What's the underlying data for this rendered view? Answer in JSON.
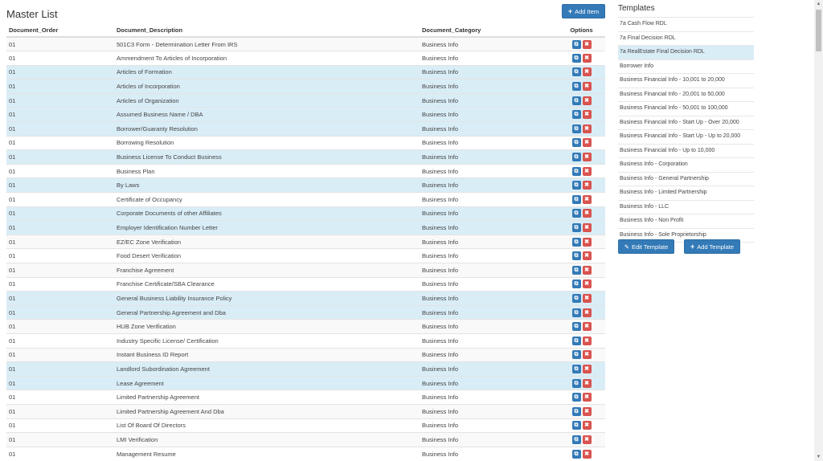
{
  "main": {
    "title": "Master List",
    "add_item_label": "Add Item",
    "columns": [
      "Document_Order",
      "Document_Description",
      "Document_Category",
      "Options"
    ],
    "rows": [
      {
        "order": "01",
        "desc": "501C3 Form - Determination Letter From IRS",
        "cat": "Business Info",
        "hl": false
      },
      {
        "order": "01",
        "desc": "Ammendment To Articles of Incorporation",
        "cat": "Business Info",
        "hl": false
      },
      {
        "order": "01",
        "desc": "Articles of Formation",
        "cat": "Business Info",
        "hl": true
      },
      {
        "order": "01",
        "desc": "Articles of Incorporation",
        "cat": "Business Info",
        "hl": true
      },
      {
        "order": "01",
        "desc": "Articles of Organization",
        "cat": "Business Info",
        "hl": true
      },
      {
        "order": "01",
        "desc": "Assumed Business Name / DBA",
        "cat": "Business Info",
        "hl": true
      },
      {
        "order": "01",
        "desc": "Borrower/Guaranty Resolution",
        "cat": "Business Info",
        "hl": true
      },
      {
        "order": "01",
        "desc": "Borrowing Resolution",
        "cat": "Business Info",
        "hl": false
      },
      {
        "order": "01",
        "desc": "Business License To Conduct Business",
        "cat": "Business Info",
        "hl": true
      },
      {
        "order": "01",
        "desc": "Business Plan",
        "cat": "Business Info",
        "hl": false
      },
      {
        "order": "01",
        "desc": "By Laws",
        "cat": "Business Info",
        "hl": true
      },
      {
        "order": "01",
        "desc": "Certificate of Occupancy",
        "cat": "Business Info",
        "hl": false
      },
      {
        "order": "01",
        "desc": "Corporate Documents of other Affiliates",
        "cat": "Business Info",
        "hl": true
      },
      {
        "order": "01",
        "desc": "Employer Identification Number Letter",
        "cat": "Business Info",
        "hl": true
      },
      {
        "order": "01",
        "desc": "EZ/EC Zone Verification",
        "cat": "Business Info",
        "hl": false
      },
      {
        "order": "01",
        "desc": "Food Desert Verification",
        "cat": "Business Info",
        "hl": false
      },
      {
        "order": "01",
        "desc": "Franchise Agreement",
        "cat": "Business Info",
        "hl": false
      },
      {
        "order": "01",
        "desc": "Franchise Certificate/SBA Clearance",
        "cat": "Business Info",
        "hl": false
      },
      {
        "order": "01",
        "desc": "General Business Liability Insurance Policy",
        "cat": "Business Info",
        "hl": true
      },
      {
        "order": "01",
        "desc": "General Partnership Agreement and Dba",
        "cat": "Business Info",
        "hl": true
      },
      {
        "order": "01",
        "desc": "HUB Zone Verification",
        "cat": "Business Info",
        "hl": false
      },
      {
        "order": "01",
        "desc": "Industry Specific License/ Certification",
        "cat": "Business Info",
        "hl": false
      },
      {
        "order": "01",
        "desc": "Instant Business ID Report",
        "cat": "Business Info",
        "hl": false
      },
      {
        "order": "01",
        "desc": "Landlord Subordination Agreement",
        "cat": "Business Info",
        "hl": true
      },
      {
        "order": "01",
        "desc": "Lease Agreement",
        "cat": "Business Info",
        "hl": true
      },
      {
        "order": "01",
        "desc": "Limited Partnership Agreement",
        "cat": "Business Info",
        "hl": false
      },
      {
        "order": "01",
        "desc": "Limited Partnership Agreement And Dba",
        "cat": "Business Info",
        "hl": false
      },
      {
        "order": "01",
        "desc": "List Of Board Of Directors",
        "cat": "Business Info",
        "hl": false
      },
      {
        "order": "01",
        "desc": "LMI Verification",
        "cat": "Business Info",
        "hl": false
      },
      {
        "order": "01",
        "desc": "Management Resume",
        "cat": "Business Info",
        "hl": false
      }
    ]
  },
  "templates": {
    "title": "Templates",
    "items": [
      "7a Cash Flow RDL",
      "7a Final Decision RDL",
      "7a RealEstate Final Decision RDL",
      "Borrower Info",
      "Business Financial Info - 10,001 to 20,000",
      "Business Financial Info - 20,001 to 50,000",
      "Business Financial Info - 50,001 to 100,000",
      "Business Financial Info - Start Up - Over 20,000",
      "Business Financial Info - Start Up - Up to 20,000",
      "Business Financial Info - Up to 10,000",
      "Business Info - Corporation",
      "Business Info - General Partnership",
      "Business Info - Limited Partnership",
      "Business Info - LLC",
      "Business Info - Non Profit",
      "Business Info - Sole Proprietorship"
    ],
    "active_index": 2,
    "edit_label": "Edit Template",
    "add_label": "Add Template"
  },
  "icons": {
    "add": "plus-icon",
    "edit": "edit-icon",
    "delete": "delete-icon",
    "pencil": "pencil-icon"
  },
  "colors": {
    "primary": "#337ab7",
    "danger": "#d9534f",
    "highlight": "#d9edf7"
  }
}
